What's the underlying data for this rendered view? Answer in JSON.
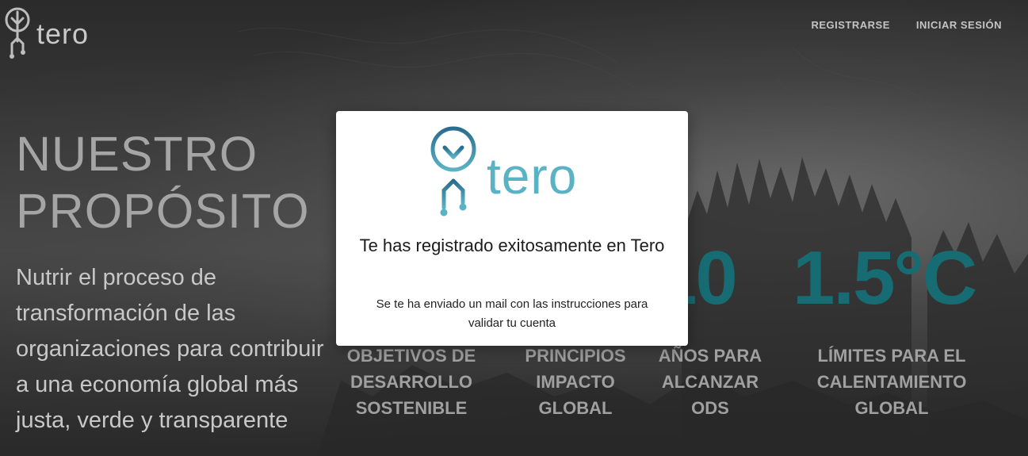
{
  "brand": {
    "name": "tero"
  },
  "nav": {
    "register": "REGISTRARSE",
    "login": "INICIAR SESIÓN"
  },
  "hero": {
    "title_line1": "NUESTRO",
    "title_line2": "PROPÓSITO",
    "text": "Nutrir el proceso de transformación de las organizaciones para contribuir a una economía global más justa, verde y transparente"
  },
  "stats": [
    {
      "value": "",
      "label_line1": "OBJETIVOS DE",
      "label_line2": "DESARROLLO",
      "label_line3": "SOSTENIBLE"
    },
    {
      "value": "",
      "label_line1": "PRINCIPIOS",
      "label_line2": "IMPACTO",
      "label_line3": "GLOBAL"
    },
    {
      "value": "10",
      "label_line1": "AÑOS PARA",
      "label_line2": "ALCANZAR",
      "label_line3": "ODS"
    },
    {
      "value": "1.5°C",
      "label_line1": "LÍMITES PARA EL",
      "label_line2": "CALENTAMIENTO",
      "label_line3": "GLOBAL"
    }
  ],
  "modal": {
    "logo_text": "tero",
    "title": "Te has registrado exitosamente en Tero",
    "message": "Se te ha enviado un mail con las instrucciones para validar tu cuenta"
  },
  "colors": {
    "accent": "#176b72",
    "logo_blue": "#5ab3c4",
    "logo_dark": "#2a6c8f"
  }
}
